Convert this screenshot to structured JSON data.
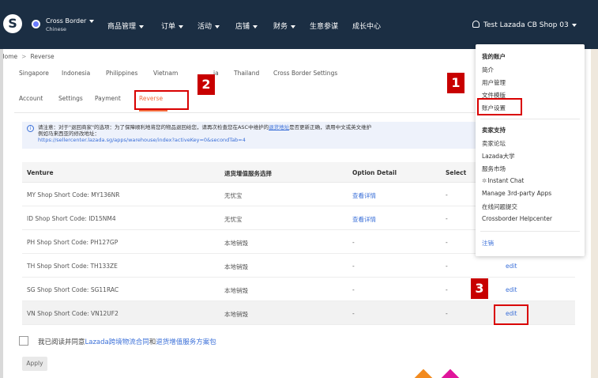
{
  "topbar": {
    "logo": "S",
    "region_name": "Cross Border",
    "region_sub": "Chinese",
    "nav": [
      "商品管理",
      "订单",
      "活动",
      "店铺",
      "财务",
      "生意参谋",
      "成长中心"
    ],
    "account_label": "Test Lazada CB Shop 03"
  },
  "breadcrumb": {
    "home": "Home",
    "current": "Reverse"
  },
  "countries": [
    "Singapore",
    "Indonesia",
    "Philippines",
    "Vietnam",
    "ia",
    "Thailand",
    "Cross Border Settings"
  ],
  "subtabs": [
    "Account",
    "Settings",
    "Payment",
    "Reverse"
  ],
  "notice": {
    "prefix": "请注意：对于\"退回商家\"的选项：为了保障顺利地将您的物品退回给您，请再次检查您在ASC中维护的",
    "link": "退货地址",
    "suffix": "是否更新正确，请用中文或英文维护",
    "line2": "例如马来西亚的修改地址：",
    "url": "https://sellercenter.lazada.sg/apps/warehouse/index?activeKey=0&secondTab=4"
  },
  "table": {
    "headers": [
      "Venture",
      "退货增值服务选择",
      "Option Detail",
      "Select"
    ],
    "rows": [
      {
        "venture": "MY Shop Short Code: MY136NR",
        "service": "无忧宝",
        "detail": "查看详情",
        "select": "-",
        "action": ""
      },
      {
        "venture": "ID Shop Short Code: ID15NM4",
        "service": "无忧宝",
        "detail": "查看详情",
        "select": "-",
        "action": ""
      },
      {
        "venture": "PH Shop Short Code: PH127GP",
        "service": "本地销毁",
        "detail": "-",
        "select": "-",
        "action": ""
      },
      {
        "venture": "TH Shop Short Code: TH133ZE",
        "service": "本地销毁",
        "detail": "-",
        "select": "-",
        "action": "edit"
      },
      {
        "venture": "SG Shop Short Code: SG11RAC",
        "service": "本地销毁",
        "detail": "-",
        "select": "-",
        "action": "edit"
      },
      {
        "venture": "VN Shop Short Code: VN12UF2",
        "service": "本地销毁",
        "detail": "-",
        "select": "-",
        "action": "edit"
      }
    ]
  },
  "agree": {
    "prefix": "我已阅读并同意",
    "link1": "Lazada跨境物流合同",
    "middle": "和",
    "link2": "退货增值服务方案包"
  },
  "apply_label": "Apply",
  "dropdown": {
    "my_account": "我的账户",
    "items1": [
      "简介",
      "用户管理",
      "文件模版",
      "账户设置"
    ],
    "seller_support": "卖家支持",
    "items2": [
      "卖家论坛",
      "Lazada大学",
      "服务市场",
      "Instant Chat",
      "Manage 3rd-party Apps",
      "在线问题提交",
      "Crossborder Helpcenter"
    ],
    "logout": "注销"
  },
  "callouts": [
    "1",
    "2",
    "3"
  ],
  "colors": {
    "nav_bg": "#1b2e43",
    "accent": "#f26a3d",
    "link": "#3a6fd8",
    "callout": "#c80000"
  }
}
